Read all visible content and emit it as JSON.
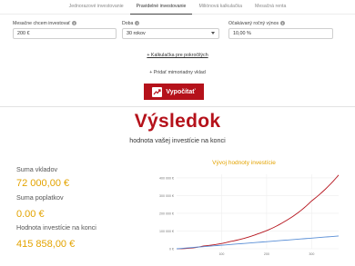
{
  "tabs": [
    {
      "label": "Jednorazové investovanie",
      "active": false
    },
    {
      "label": "Pravidelné investovanie",
      "active": true
    },
    {
      "label": "Miliónová kalkulačka",
      "active": false
    },
    {
      "label": "Mesačná renta",
      "active": false
    }
  ],
  "form": {
    "monthly_label": "Mesačne chcem investovať",
    "monthly_value": "200 €",
    "period_label": "Doba",
    "period_value": "30 rokov",
    "return_label": "Očakávaný ročný výnos",
    "return_value": "10,00 %",
    "info_glyph": "i"
  },
  "advanced_link": "+ Kalkulačka pre pokročilých",
  "add_deposit": "+ Pridať mimoriadny vklad",
  "calc_button": "Vypočítať",
  "result": {
    "title": "Výsledok",
    "subtitle": "hodnota vašej investície na konci",
    "deposits_label": "Suma vkladov",
    "deposits_value": "72 000,00 €",
    "fees_label": "Suma poplatkov",
    "fees_value": "0.00 €",
    "final_label": "Hodnota investície na konci",
    "final_value": "415 858,00 €"
  },
  "chart_data": {
    "type": "line",
    "title": "Vývoj hodnoty investície",
    "y_ticks": [
      "0 €",
      "100 000 €",
      "200 000 €",
      "300 000 €",
      "400 000 €"
    ],
    "x_ticks": [
      "100",
      "200",
      "300"
    ],
    "xlim": [
      0,
      360
    ],
    "ylim": [
      0,
      420000
    ],
    "series": [
      {
        "color": "#b5121b",
        "x": [
          0,
          60,
          120,
          180,
          240,
          300,
          360
        ],
        "values": [
          0,
          15500,
          41100,
          83600,
          153700,
          269700,
          415858
        ]
      },
      {
        "color": "#5a8fd6",
        "x": [
          0,
          60,
          120,
          180,
          240,
          300,
          360
        ],
        "values": [
          0,
          12000,
          24000,
          36000,
          48000,
          60000,
          72000
        ]
      }
    ]
  }
}
